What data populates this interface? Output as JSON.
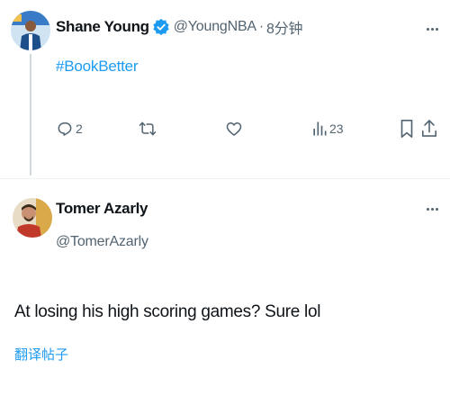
{
  "tweet1": {
    "display_name": "Shane Young",
    "handle": "@YoungNBA",
    "separator": "·",
    "time": "8分钟",
    "hashtag": "#BookBetter",
    "reply_count": "2",
    "view_count": "23",
    "icons": [
      "verified-badge-icon",
      "more-icon",
      "reply-icon",
      "retweet-icon",
      "like-icon",
      "views-icon",
      "bookmark-icon",
      "share-icon"
    ]
  },
  "tweet2": {
    "display_name": "Tomer Azarly",
    "handle": "@TomerAzarly",
    "text": "At losing his high scoring games? Sure lol",
    "translate_label": "翻译帖子"
  },
  "colors": {
    "text": "#0f1419",
    "secondary": "#536471",
    "accent": "#1d9bf0",
    "divider": "#eff3f4"
  }
}
